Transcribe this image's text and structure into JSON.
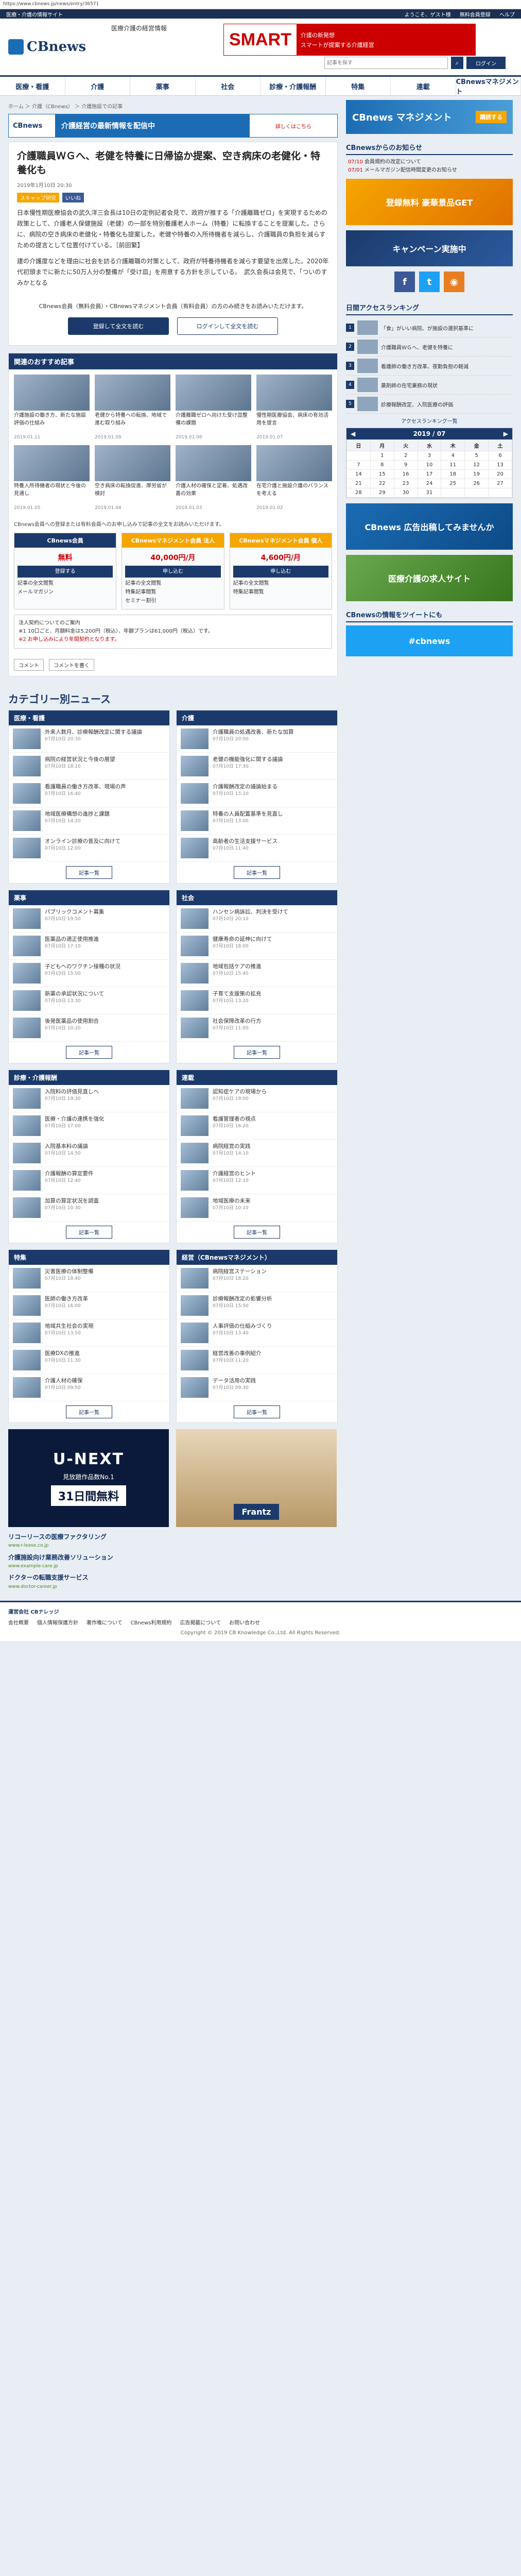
{
  "browser": {
    "url": "https://www.cbnews.jp/news/entry/36571"
  },
  "topbar": {
    "left": "医療・介護の情報サイト",
    "welcome": "ようこそ、ゲスト様",
    "member": "無料会員登録",
    "help": "ヘルプ"
  },
  "header": {
    "logo": "CBnews",
    "logo_sub": "医療介護の経営情報",
    "banner_big": "SMART",
    "banner_line1": "介護の新発想",
    "banner_line2": "スマートが提案する介護経営",
    "search_placeholder": "記事を探す",
    "login": "ログイン"
  },
  "nav": [
    "医療・看護",
    "介護",
    "薬事",
    "社会",
    "診療・介護報酬",
    "特集",
    "連載",
    "CBnewsマネジメント"
  ],
  "breadcrumb": "ホーム ＞ 介護（CBnews） ＞ 介護施設での記事",
  "notice_banner": {
    "l": "CBnews",
    "m": "介護経営の最新情報を配信中",
    "r": "詳しくはこちら"
  },
  "article": {
    "title": "介護職員ＷＧへ、老健を特養に日帰協か提案、空き病床の老健化・特養化も",
    "date": "2019年1月10日 20:30",
    "tag": "スキャップ研究",
    "like": "いいね",
    "p1": "日本慢性期医療協会の武久洋三会長は10日の定例記者会見で、政府が推する「介護離職ゼロ」を実現するための政策として、介護老人保健施設（老健）の一部を特別養護老人ホーム（特養）に転換することを提案した。さらに、病院の空き病床の老健化・特養化も提案した。老健や特養の入所待機者を減らし、介護職員の負担を減らすための提言として位置付けている。［前田繁】",
    "p2": "建の介護度などを理由に社会を訪る介護離職の対策として、政府が特養待機者を減らす要望を出席した。2020年代初頭までに新たに50万人分の整備が「受け皿」を用意する方針を示している。　武久会長は会見で、「ついのすみかとなる",
    "pay_note": "CBnews会員（無料会員）・CBnewsマネジメント会員（有料会員）の方のみ続きをお読みいただけます。",
    "btn_register": "登録して全文を読む",
    "btn_login": "ログインして全文を読む"
  },
  "recommend": {
    "title": "関連のおすすめ記事",
    "items": [
      {
        "t": "介護施設の働き方、新たな施設評価の仕組み",
        "d": "2019.01.11"
      },
      {
        "t": "老健から特養への転換、地域で進む取り組み",
        "d": "2019.01.09"
      },
      {
        "t": "介護離職ゼロへ向けた受け皿整備の課題",
        "d": "2019.01.08"
      },
      {
        "t": "慢性期医療協会、病床の有効活用を提言",
        "d": "2019.01.07"
      },
      {
        "t": "特養入所待機者の現状と今後の見通し",
        "d": "2019.01.05"
      },
      {
        "t": "空き病床の転換促進、厚労省が検討",
        "d": "2019.01.04"
      },
      {
        "t": "介護人材の確保と定着、処遇改善の効果",
        "d": "2019.01.03"
      },
      {
        "t": "在宅介護と施設介護のバランスを考える",
        "d": "2019.01.02"
      }
    ]
  },
  "plans": {
    "note": "CBnews会員への登録または有料会員へのお申し込みで記事の全文をお読みいただけます。",
    "cols": [
      {
        "head": "CBnews会員",
        "price": "無料",
        "btn": "登録する",
        "svc": [
          "記事の全文閲覧",
          "メールマガジン"
        ]
      },
      {
        "head": "CBnewsマネジメント会員 法人",
        "price": "40,000円/月",
        "btn": "申し込む",
        "svc": [
          "記事の全文閲覧",
          "特集記事閲覧",
          "セミナー割引"
        ]
      },
      {
        "head": "CBnewsマネジメント会員 個人",
        "price": "4,600円/月",
        "btn": "申し込む",
        "svc": [
          "記事の全文閲覧",
          "特集記事閲覧"
        ]
      }
    ]
  },
  "info_box": {
    "l1": "法人契約についてのご案内",
    "l2": "※1 10口ごと、月額料金は5,200円（税込）、年額プランは61,000円（税込）です。",
    "l3": "※2 お申し込みにより年間契約となります。"
  },
  "share": {
    "comment": "コメント",
    "fb": "コメントを書く"
  },
  "categories": {
    "title": "カテゴリー別ニュース",
    "boxes": [
      {
        "head": "医療・看護",
        "rows": [
          {
            "t": "外来人数月、診療報酬改定に関する議論",
            "d": "07月10日 20:30"
          },
          {
            "t": "病院の経営状況と今後の展望",
            "d": "07月10日 18:10"
          },
          {
            "t": "看護職員の働き方改革、現場の声",
            "d": "07月10日 16:40"
          },
          {
            "t": "地域医療構想の進捗と課題",
            "d": "07月10日 14:20"
          },
          {
            "t": "オンライン診療の普及に向けて",
            "d": "07月10日 12:00"
          }
        ],
        "more": "記事一覧"
      },
      {
        "head": "介護",
        "rows": [
          {
            "t": "介護職員の処遇改善、新たな加算",
            "d": "07月10日 20:00"
          },
          {
            "t": "老健の機能強化に関する議論",
            "d": "07月10日 17:30"
          },
          {
            "t": "介護報酬改定の議論始まる",
            "d": "07月10日 15:10"
          },
          {
            "t": "特養の人員配置基準を見直し",
            "d": "07月10日 13:00"
          },
          {
            "t": "高齢者の生活支援サービス",
            "d": "07月10日 11:40"
          }
        ],
        "more": "記事一覧"
      },
      {
        "head": "薬事",
        "rows": [
          {
            "t": "パブリックコメント募集",
            "d": "07月10日 19:50"
          },
          {
            "t": "医薬品の適正使用推進",
            "d": "07月10日 17:10"
          },
          {
            "t": "子どもへのワクチン接種の状況",
            "d": "07月10日 15:00"
          },
          {
            "t": "新薬の承認状況について",
            "d": "07月10日 13:30"
          },
          {
            "t": "後発医薬品の使用割合",
            "d": "07月10日 10:20"
          }
        ],
        "more": "記事一覧"
      },
      {
        "head": "社会",
        "rows": [
          {
            "t": "ハンセン病訴訟、判決を受けて",
            "d": "07月10日 20:10"
          },
          {
            "t": "健康寿命の延伸に向けて",
            "d": "07月10日 18:00"
          },
          {
            "t": "地域包括ケアの推進",
            "d": "07月10日 15:40"
          },
          {
            "t": "子育て支援策の拡充",
            "d": "07月10日 13:20"
          },
          {
            "t": "社会保障改革の行方",
            "d": "07月10日 11:00"
          }
        ],
        "more": "記事一覧"
      },
      {
        "head": "診療・介護報酬",
        "rows": [
          {
            "t": "入院料の評価見直しへ",
            "d": "07月10日 19:30"
          },
          {
            "t": "医療・介護の連携を強化",
            "d": "07月10日 17:00"
          },
          {
            "t": "入院基本料の議論",
            "d": "07月10日 14:50"
          },
          {
            "t": "介護報酬の算定要件",
            "d": "07月10日 12:40"
          },
          {
            "t": "加算の算定状況を調査",
            "d": "07月10日 10:30"
          }
        ],
        "more": "記事一覧"
      },
      {
        "head": "連載",
        "rows": [
          {
            "t": "認知症ケアの現場から",
            "d": "07月10日 19:00"
          },
          {
            "t": "看護管理者の視点",
            "d": "07月10日 16:20"
          },
          {
            "t": "病院経営の実践",
            "d": "07月10日 14:10"
          },
          {
            "t": "介護経営のヒント",
            "d": "07月10日 12:10"
          },
          {
            "t": "地域医療の未来",
            "d": "07月10日 10:10"
          }
        ],
        "more": "記事一覧"
      },
      {
        "head": "特集",
        "rows": [
          {
            "t": "災害医療の体制整備",
            "d": "07月10日 18:40"
          },
          {
            "t": "医師の働き方改革",
            "d": "07月10日 16:00"
          },
          {
            "t": "地域共生社会の実現",
            "d": "07月10日 13:50"
          },
          {
            "t": "医療DXの推進",
            "d": "07月10日 11:30"
          },
          {
            "t": "介護人材の確保",
            "d": "07月10日 09:50"
          }
        ],
        "more": "記事一覧"
      },
      {
        "head": "経営（CBnewsマネジメント）",
        "rows": [
          {
            "t": "病院経営ステーション",
            "d": "07月10日 18:20"
          },
          {
            "t": "診療報酬改定の影響分析",
            "d": "07月10日 15:50"
          },
          {
            "t": "人事評価の仕組みづくり",
            "d": "07月10日 13:40"
          },
          {
            "t": "経営改善の事例紹介",
            "d": "07月10日 11:20"
          },
          {
            "t": "データ活用の実践",
            "d": "07月10日 09:30"
          }
        ],
        "more": "記事一覧"
      }
    ]
  },
  "ads": {
    "unext_name": "U-NEXT",
    "unext_sub": "見放題作品数No.1",
    "unext_box": "31日間無料",
    "right_label": "Frantz",
    "text": [
      {
        "ttl": "リコーリースの医療ファクタリング",
        "u": "www.r-lease.co.jp"
      },
      {
        "ttl": "介護施設向け業務改善ソリューション",
        "u": "www.example-care.jp"
      },
      {
        "ttl": "ドクターの転職支援サービス",
        "u": "www.doctor-career.jp"
      }
    ]
  },
  "sidebar": {
    "ad1": "CBnews マネジメント",
    "ad1_btn": "購読する",
    "notice_head": "CBnewsからのお知らせ",
    "notices": [
      {
        "d": "07/10",
        "t": "会員規約の改定について"
      },
      {
        "d": "07/01",
        "t": "メールマガジン配信時間変更のお知らせ"
      }
    ],
    "banner1": "登録無料 豪華景品GET",
    "banner2": "キャンペーン実施中",
    "banner3": "CBnews 無料会員登録",
    "rank_head": "日間アクセスランキング",
    "ranks": [
      "「食」がいい病院、が施設の選択基準に",
      "介護職員ＷＧへ、老健を特養に",
      "看護師の働き方改革、夜勤負担の軽減",
      "薬剤師の在宅業務の現状",
      "診療報酬改定、入院医療の評価"
    ],
    "rank_more": "アクセスランキング一覧",
    "cal_head": "2019 / 07",
    "cal_days": [
      "日",
      "月",
      "火",
      "水",
      "木",
      "金",
      "土"
    ],
    "cal_rows": [
      [
        "",
        "1",
        "2",
        "3",
        "4",
        "5",
        "6"
      ],
      [
        "7",
        "8",
        "9",
        "10",
        "11",
        "12",
        "13"
      ],
      [
        "14",
        "15",
        "16",
        "17",
        "18",
        "19",
        "20"
      ],
      [
        "21",
        "22",
        "23",
        "24",
        "25",
        "26",
        "27"
      ],
      [
        "28",
        "29",
        "30",
        "31",
        "",
        "",
        ""
      ]
    ],
    "banner4": "CBnews 広告出稿してみませんか",
    "banner5": "医療介護の求人サイト",
    "twitter_head": "CBnewsの情報をツイートにも",
    "twitter_tag": "#cbnews"
  },
  "footer": {
    "company": "運営会社 CBナレッジ",
    "links": [
      "会社概要",
      "個人情報保護方針",
      "著作権について",
      "CBnews利用規約",
      "広告掲載について",
      "お問い合わせ"
    ],
    "copy": "Copyright © 2019 CB Knowledge Co.,Ltd. All Rights Reserved."
  }
}
